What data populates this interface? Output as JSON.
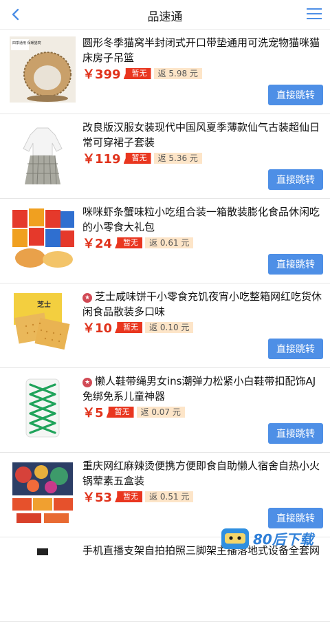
{
  "header": {
    "title": "品速通"
  },
  "colors": {
    "accent": "#4e8fe6",
    "price": "#e0321b",
    "tag": "#e9361f",
    "rebate_bg": "#fde5c8"
  },
  "items": [
    {
      "name": "圆形冬季猫窝半封闭式开口带垫通用可洗宠物猫咪猫床房子吊篮",
      "price": "￥399",
      "tag": "暂无",
      "rebate": "返 5.98 元",
      "button": "直接跳转",
      "thumb_label": "四季通用 保暖猫窝",
      "tmall": false
    },
    {
      "name": "改良版汉服女装现代中国风夏季薄款仙气古装超仙日常可穿裙子套装",
      "price": "￥119",
      "tag": "暂无",
      "rebate": "返 5.36 元",
      "button": "直接跳转",
      "thumb_label": "",
      "tmall": false
    },
    {
      "name": "咪咪虾条蟹味粒小吃组合装一箱散装膨化食品休闲吃的小零食大礼包",
      "price": "￥24",
      "tag": "暂无",
      "rebate": "返 0.61 元",
      "button": "直接跳转",
      "thumb_label": "",
      "tmall": false
    },
    {
      "name": "芝士咸味饼干小零食充饥夜宵小吃整箱网红吃货休闲食品散装多口味",
      "price": "￥10",
      "tag": "暂无",
      "rebate": "返 0.10 元",
      "button": "直接跳转",
      "thumb_label": "芝士",
      "tmall": true
    },
    {
      "name": "懒人鞋带绳男女ins潮弹力松紧小白鞋带扣配饰AJ免绑免系儿童神器",
      "price": "￥5",
      "tag": "暂无",
      "rebate": "返 0.07 元",
      "button": "直接跳转",
      "thumb_label": "",
      "tmall": true
    },
    {
      "name": "重庆网红麻辣烫便携方便即食自助懒人宿舍自热小火锅荤素五盒装",
      "price": "￥53",
      "tag": "暂无",
      "rebate": "返 0.51 元",
      "button": "直接跳转",
      "thumb_label": "",
      "tmall": false
    },
    {
      "name": "手机直播支架自拍拍照三脚架主播落地式设备全套网",
      "price": "",
      "tag": "",
      "rebate": "",
      "button": "",
      "thumb_label": "",
      "tmall": false
    }
  ],
  "tmall_glyph": "★",
  "watermark": {
    "text": "80后下载"
  }
}
